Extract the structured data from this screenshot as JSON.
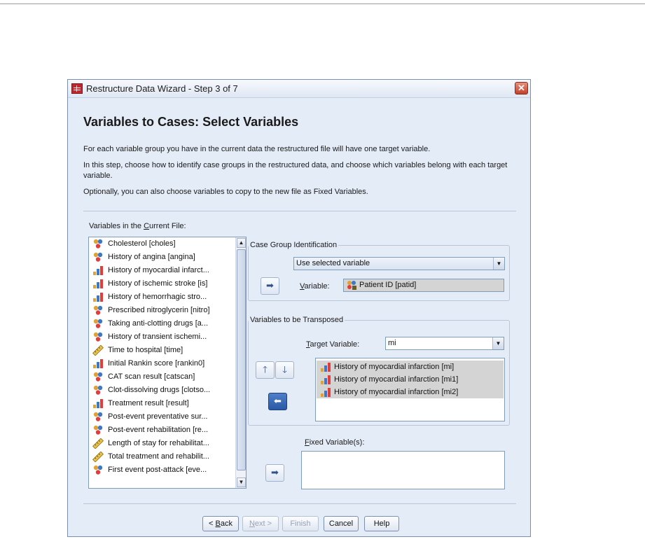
{
  "window": {
    "title": "Restructure Data Wizard - Step 3 of 7",
    "close_glyph": "✕"
  },
  "heading": "Variables to Cases: Select Variables",
  "description": {
    "line1": "For each variable group you have in the current data the restructured file will have one target variable.",
    "line2": "In this step, choose how to identify case groups in the restructured data, and choose which variables belong with each target variable.",
    "line3": "Optionally, you can also choose variables to copy to the new file as Fixed Variables."
  },
  "variables_panel": {
    "label_pre": "Variables in the ",
    "label_accel": "C",
    "label_post": "urrent File:",
    "items": [
      {
        "label": "Cholesterol [choles]",
        "icon": "nominal-icon"
      },
      {
        "label": "History of angina [angina]",
        "icon": "nominal-icon"
      },
      {
        "label": "History of myocardial infarct...",
        "icon": "ordinal-icon"
      },
      {
        "label": "History of ischemic stroke [is]",
        "icon": "ordinal-icon"
      },
      {
        "label": "History of hemorrhagic stro...",
        "icon": "ordinal-icon"
      },
      {
        "label": "Prescribed nitroglycerin [nitro]",
        "icon": "nominal-icon"
      },
      {
        "label": "Taking anti-clotting drugs [a...",
        "icon": "nominal-icon"
      },
      {
        "label": "History of transient ischemi...",
        "icon": "nominal-icon"
      },
      {
        "label": "Time to hospital [time]",
        "icon": "scale-icon"
      },
      {
        "label": "Initial Rankin score [rankin0]",
        "icon": "ordinal-icon"
      },
      {
        "label": "CAT scan result [catscan]",
        "icon": "nominal-icon"
      },
      {
        "label": "Clot-dissolving drugs [clotso...",
        "icon": "nominal-icon"
      },
      {
        "label": "Treatment result [result]",
        "icon": "ordinal-icon"
      },
      {
        "label": "Post-event preventative sur...",
        "icon": "nominal-icon"
      },
      {
        "label": "Post-event rehabilitation [re...",
        "icon": "nominal-icon"
      },
      {
        "label": "Length of stay for rehabilitat...",
        "icon": "scale-icon"
      },
      {
        "label": "Total treatment and rehabilit...",
        "icon": "scale-icon"
      },
      {
        "label": "First event post-attack [eve...",
        "icon": "nominal-icon"
      }
    ]
  },
  "case_group": {
    "legend": "Case Group Identification",
    "method": "Use selected variable",
    "variable_label_pre": "V",
    "variable_label_post": "ariable:",
    "variable_value": "Patient ID [patid]"
  },
  "transposed": {
    "legend": "Variables to be Transposed",
    "target_label_pre": "T",
    "target_label_post": "arget Variable:",
    "target_value": "mi",
    "items": [
      "History of myocardial infarction [mi]",
      "History of myocardial infarction [mi1]",
      "History of myocardial infarction [mi2]"
    ]
  },
  "fixed": {
    "label_pre": "F",
    "label_post": "ixed Variable(s):"
  },
  "buttons": {
    "back_prefix": "< ",
    "back_accel": "B",
    "back_rest": "ack",
    "next_accel": "N",
    "next_rest": "ext >",
    "finish": "Finish",
    "cancel": "Cancel",
    "help": "Help"
  },
  "colors": {
    "dialog_bg": "#e4ecf7",
    "selection_gray": "#d4d4d4",
    "accent_blue": "#2a59a5"
  }
}
